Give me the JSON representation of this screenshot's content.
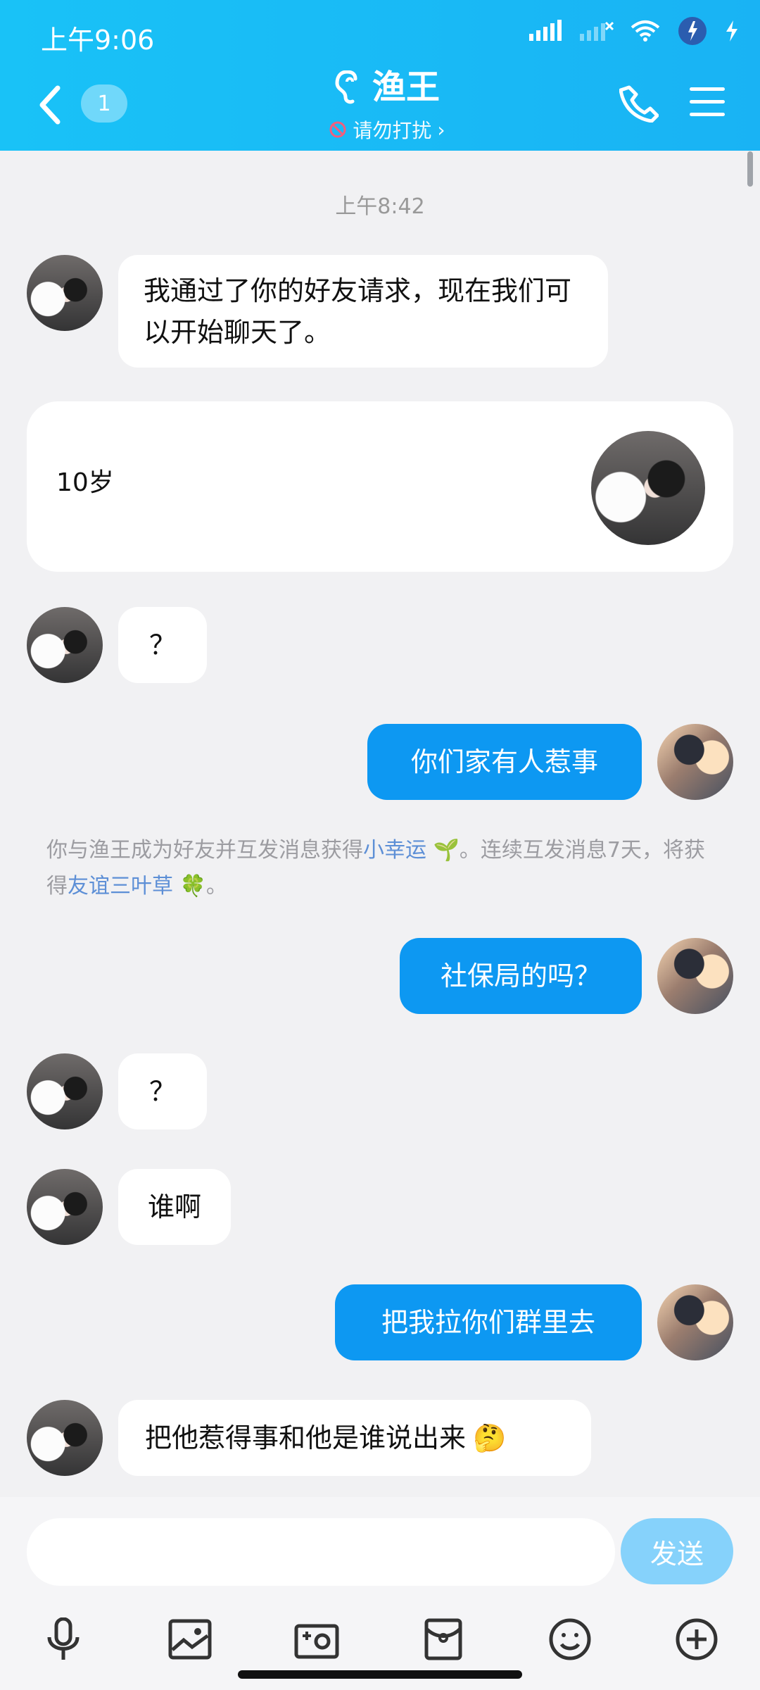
{
  "status": {
    "time": "上午9:06"
  },
  "header": {
    "unread_count": "1",
    "title": "渔王",
    "subtitle": "请勿打扰"
  },
  "chat": {
    "timestamp": "上午8:42",
    "messages": [
      {
        "side": "left",
        "text": "我通过了你的好友请求，现在我们可以开始聊天了。"
      },
      {
        "side": "card",
        "text": "10岁"
      },
      {
        "side": "left",
        "text": "？"
      },
      {
        "side": "right",
        "text": "你们家有人惹事"
      },
      {
        "side": "system",
        "text_parts": [
          "你与渔王成为好友并互发消息获得",
          "小幸运",
          "。连续互发消息7天，将获得",
          "友谊三叶草",
          "。"
        ]
      },
      {
        "side": "right",
        "text": "社保局的吗？"
      },
      {
        "side": "left",
        "text": "？"
      },
      {
        "side": "left",
        "text": "谁啊"
      },
      {
        "side": "right",
        "text": "把我拉你们群里去"
      },
      {
        "side": "left",
        "text": "把他惹得事和他是谁说出来"
      }
    ]
  },
  "input": {
    "placeholder": "",
    "send_label": "发送"
  },
  "toolbar": {
    "icons": [
      "microphone-icon",
      "image-icon",
      "camera-icon",
      "red-packet-icon",
      "emoji-icon",
      "add-icon"
    ]
  },
  "colors": {
    "header_bg": "#19b3f4",
    "sent_bubble": "#0d98f2",
    "send_button": "#86d2fb"
  }
}
